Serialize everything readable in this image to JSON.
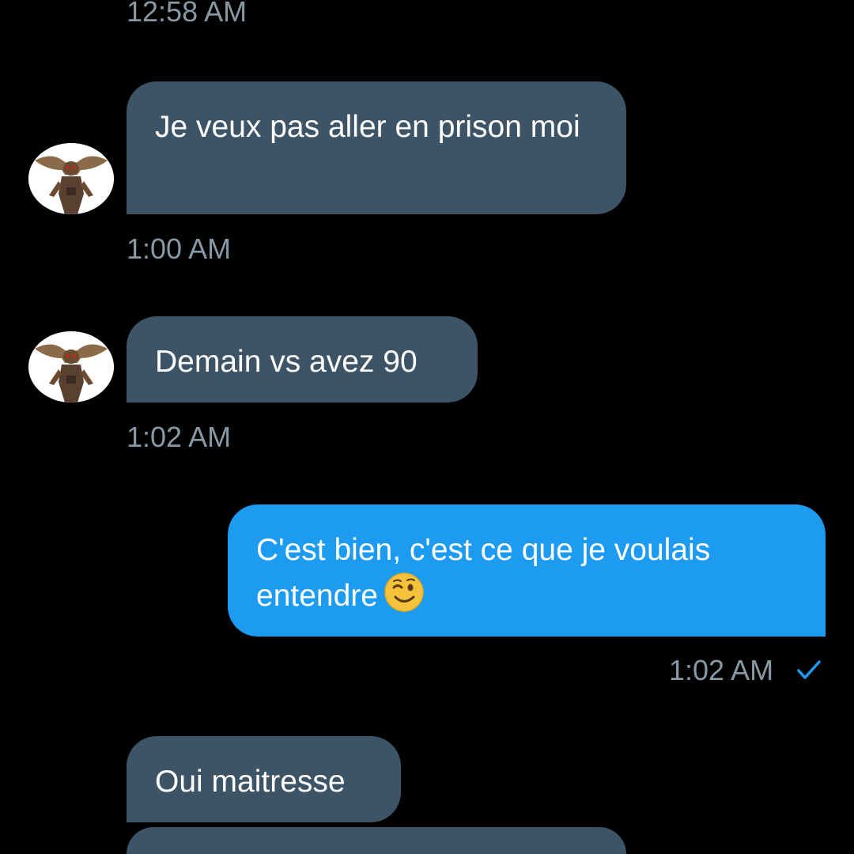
{
  "conversation": {
    "top_timestamp": "12:58 AM",
    "messages": [
      {
        "direction": "received",
        "text": "Je veux pas aller en prison moi",
        "timestamp": "1:00 AM",
        "avatar_icon": "gremlin-avatar-icon"
      },
      {
        "direction": "received",
        "text": "Demain vs avez 90",
        "timestamp": "1:02 AM",
        "avatar_icon": "gremlin-avatar-icon"
      },
      {
        "direction": "sent",
        "text": "C'est bien, c'est ce que je voulais entendre",
        "emoji": "winking-face-emoji",
        "timestamp": "1:02 AM",
        "status_icon": "read-check-icon"
      },
      {
        "direction": "received",
        "text": "Oui maitresse"
      },
      {
        "direction": "received",
        "text": ""
      }
    ]
  },
  "colors": {
    "background": "#000000",
    "received_bubble": "#3d5466",
    "sent_bubble": "#1d9bf0",
    "timestamp_text": "#8899a6",
    "check_mark": "#1d9bf0"
  }
}
